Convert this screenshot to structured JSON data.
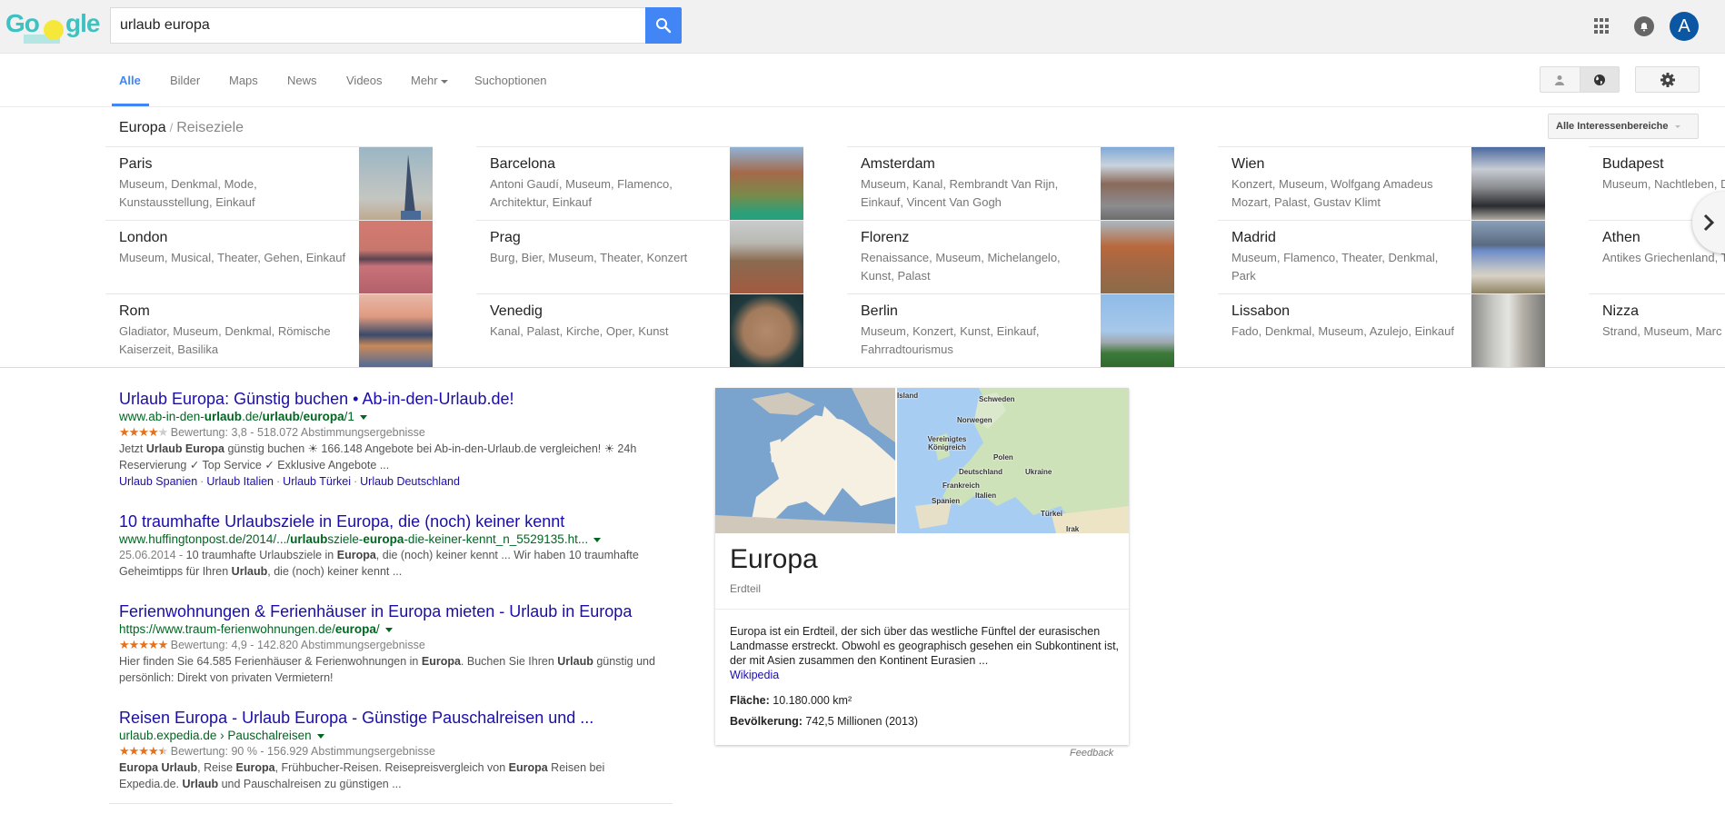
{
  "header": {
    "logo_alt": "Google",
    "search": {
      "value": "urlaub europa",
      "placeholder": ""
    },
    "avatar_initial": "A",
    "icons": [
      "search-icon",
      "apps-icon",
      "notifications-icon",
      "avatar"
    ]
  },
  "nav": {
    "tabs": [
      {
        "label": "Alle",
        "active": true
      },
      {
        "label": "Bilder"
      },
      {
        "label": "Maps"
      },
      {
        "label": "News"
      },
      {
        "label": "Videos"
      },
      {
        "label": "Mehr"
      },
      {
        "label": "Suchoptionen"
      }
    ],
    "right_icons": [
      "person-icon",
      "globe-icon",
      "gear-icon"
    ]
  },
  "breadcrumb": {
    "parent": "Europa",
    "separator": "/",
    "current": "Reiseziele"
  },
  "interests_button": "Alle Interessenbereiche",
  "destinations": [
    [
      {
        "name": "Paris",
        "tags": "Museum, Denkmal, Mode, Kunstausstellung, Einkauf"
      },
      {
        "name": "London",
        "tags": "Museum, Musical, Theater, Gehen, Einkauf"
      },
      {
        "name": "Rom",
        "tags": "Gladiator, Museum, Denkmal, Römische Kaiserzeit, Basilika"
      }
    ],
    [
      {
        "name": "Barcelona",
        "tags": "Antoni Gaudí, Museum, Flamenco, Architektur, Einkauf"
      },
      {
        "name": "Prag",
        "tags": "Burg, Bier, Museum, Theater, Konzert"
      },
      {
        "name": "Venedig",
        "tags": "Kanal, Palast, Kirche, Oper, Kunst"
      }
    ],
    [
      {
        "name": "Amsterdam",
        "tags": "Museum, Kanal, Rembrandt Van Rijn, Einkauf, Vincent Van Gogh"
      },
      {
        "name": "Florenz",
        "tags": "Renaissance, Museum, Michelangelo, Kunst, Palast"
      },
      {
        "name": "Berlin",
        "tags": "Museum, Konzert, Kunst, Einkauf, Fahrradtourismus"
      }
    ],
    [
      {
        "name": "Wien",
        "tags": "Konzert, Museum, Wolfgang Amadeus Mozart, Palast, Gustav Klimt"
      },
      {
        "name": "Madrid",
        "tags": "Museum, Flamenco, Theater, Denkmal, Park"
      },
      {
        "name": "Lissabon",
        "tags": "Fado, Denkmal, Museum, Azulejo, Einkauf"
      }
    ],
    [
      {
        "name": "Budapest",
        "tags": "Museum, Nachtleben, Denkmal"
      },
      {
        "name": "Athen",
        "tags": "Antikes Griechenland, Theater, Tempel"
      },
      {
        "name": "Nizza",
        "tags": "Strand, Museum, Marc Matisse, Markt"
      }
    ]
  ],
  "results": [
    {
      "title": "Urlaub Europa: Günstig buchen • Ab-in-den-Urlaub.de!",
      "url_parts": [
        [
          "www.ab-in-den-",
          false
        ],
        [
          "urlaub",
          true
        ],
        [
          ".de/",
          false
        ],
        [
          "urlaub",
          true
        ],
        [
          "/",
          false
        ],
        [
          "europa",
          true
        ],
        [
          "/1",
          false
        ]
      ],
      "rating": {
        "stars": 3.8,
        "text": "Bewertung: 3,8 - 518.072 Abstimmungsergebnisse"
      },
      "snippet_parts": [
        [
          "Jetzt ",
          false
        ],
        [
          "Urlaub Europa",
          true
        ],
        [
          " günstig buchen ☀ 166.148 Angebote bei Ab-in-den-Urlaub.de vergleichen! ☀ 24h Reservierung ✓ Top Service ✓ Exklusive Angebote ...",
          false
        ]
      ],
      "sitelinks": [
        "Urlaub Spanien",
        "Urlaub Italien",
        "Urlaub Türkei",
        "Urlaub Deutschland"
      ]
    },
    {
      "title": "10 traumhafte Urlaubsziele in Europa, die (noch) keiner kennt",
      "url_parts": [
        [
          "www.huffingtonpost.de/2014/.../",
          false
        ],
        [
          "urlaub",
          true
        ],
        [
          "sziele-",
          false
        ],
        [
          "europa",
          true
        ],
        [
          "-die-keiner-kennt_n_5529135.ht...",
          false
        ]
      ],
      "date": "25.06.2014 - ",
      "snippet_parts": [
        [
          "10 traumhafte Urlaubsziele in ",
          false
        ],
        [
          "Europa",
          true
        ],
        [
          ", die (noch) keiner kennt ... Wir haben 10 traumhafte Geheimtipps für Ihren ",
          false
        ],
        [
          "Urlaub",
          true
        ],
        [
          ", die (noch) keiner kennt ...",
          false
        ]
      ]
    },
    {
      "title": "Ferienwohnungen & Ferienhäuser in Europa mieten - Urlaub in Europa",
      "url_parts": [
        [
          "https://www.traum-ferienwohnungen.de/",
          false
        ],
        [
          "europa",
          true
        ],
        [
          "/",
          false
        ]
      ],
      "rating": {
        "stars": 4.9,
        "text": "Bewertung: 4,9 - 142.820 Abstimmungsergebnisse"
      },
      "snippet_parts": [
        [
          "Hier finden Sie 64.585 Ferienhäuser & Ferienwohnungen in ",
          false
        ],
        [
          "Europa",
          true
        ],
        [
          ". Buchen Sie Ihren ",
          false
        ],
        [
          "Urlaub",
          true
        ],
        [
          " günstig und persönlich: Direkt von privaten Vermietern!",
          false
        ]
      ]
    },
    {
      "title": "Reisen Europa - Urlaub Europa - Günstige Pauschalreisen und ...",
      "url_parts": [
        [
          "urlaub.expedia.de › Pauschalreisen",
          false
        ]
      ],
      "rating": {
        "stars": 4.5,
        "text": "Bewertung: 90 % - 156.929 Abstimmungsergebnisse"
      },
      "snippet_parts": [
        [
          "Europa Urlaub",
          true
        ],
        [
          ", Reise ",
          false
        ],
        [
          "Europa",
          true
        ],
        [
          ", Frühbucher-Reisen. Reisepreisvergleich von ",
          false
        ],
        [
          "Europa",
          true
        ],
        [
          " Reisen bei Expedia.de. ",
          false
        ],
        [
          "Urlaub",
          true
        ],
        [
          " und Pauschalreisen zu günstigen ...",
          false
        ]
      ]
    }
  ],
  "knowledge_panel": {
    "title": "Europa",
    "subtitle": "Erdteil",
    "description": "Europa ist ein Erdteil, der sich über das westliche Fünftel der eurasischen Landmasse erstreckt. Obwohl es geographisch gesehen ein Subkontinent ist, der mit Asien zusammen den Kontinent Eurasien ...",
    "source_link": "Wikipedia",
    "facts": [
      {
        "label": "Fläche:",
        "value": "10.180.000 km²"
      },
      {
        "label": "Bevölkerung:",
        "value": "742,5 Millionen (2013)"
      }
    ],
    "map_labels": [
      "Island",
      "Schweden",
      "Norwegen",
      "Vereinigtes Königreich",
      "Polen",
      "Deutschland",
      "Ukraine",
      "Frankreich",
      "Italien",
      "Spanien",
      "Türkei",
      "Irak"
    ],
    "feedback": "Feedback"
  },
  "colors": {
    "accent": "#4285f4",
    "link": "#1a0dab",
    "url": "#006621",
    "star": "#e7711b",
    "avatar": "#0b57a3"
  }
}
